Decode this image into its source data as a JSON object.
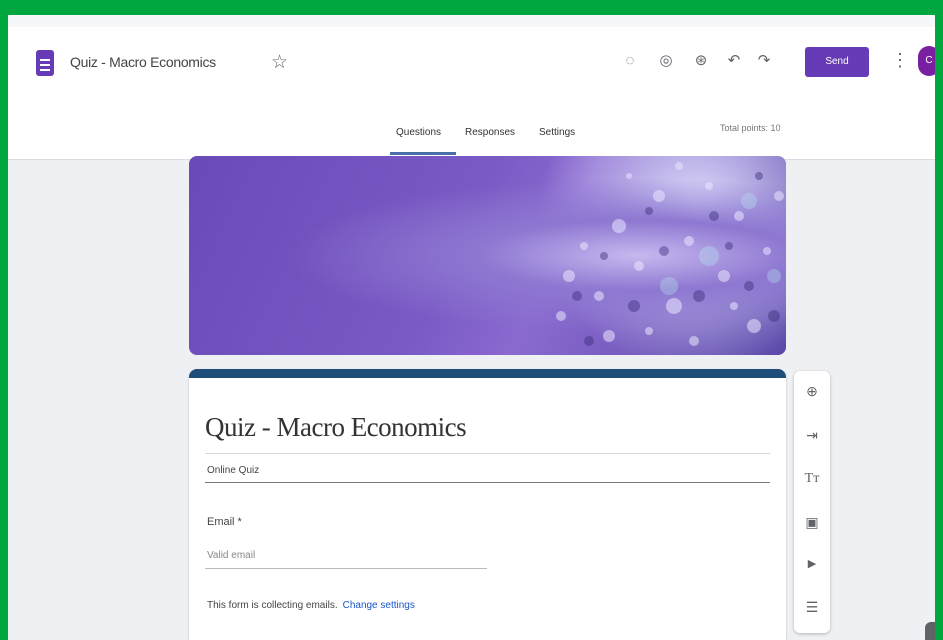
{
  "app": {
    "title": "Quiz - Macro Economics",
    "star_glyph": "☆",
    "send_label": "Send",
    "avatar_initial": "C",
    "kebab_glyph": "⋮",
    "toolbar_icons": [
      {
        "name": "customize-theme-icon",
        "glyph": "◌"
      },
      {
        "name": "preview-icon",
        "glyph": "◎"
      },
      {
        "name": "addons-icon",
        "glyph": "⊛"
      },
      {
        "name": "undo-icon",
        "glyph": "↶"
      },
      {
        "name": "redo-icon",
        "glyph": "↷"
      }
    ]
  },
  "tabs": [
    {
      "label": "Questions",
      "active": true
    },
    {
      "label": "Responses",
      "active": false
    },
    {
      "label": "Settings",
      "active": false
    }
  ],
  "total_points": "Total points: 10",
  "form": {
    "title": "Quiz - Macro Economics",
    "description": "Online Quiz",
    "email_label": "Email *",
    "email_placeholder": "Valid email",
    "collect_note": "This form is collecting emails.",
    "change_settings": "Change settings"
  },
  "side_toolbar": [
    {
      "name": "add-question-icon",
      "glyph": "⊕"
    },
    {
      "name": "import-questions-icon",
      "glyph": "⇥"
    },
    {
      "name": "add-title-icon",
      "glyph": "Tт"
    },
    {
      "name": "add-image-icon",
      "glyph": "▣"
    },
    {
      "name": "add-video-icon",
      "glyph": "▶"
    },
    {
      "name": "add-section-icon",
      "glyph": "☰"
    }
  ],
  "colors": {
    "accent": "#673ab7",
    "card_top": "#1e4f7a",
    "frame_border": "#00a63e"
  }
}
